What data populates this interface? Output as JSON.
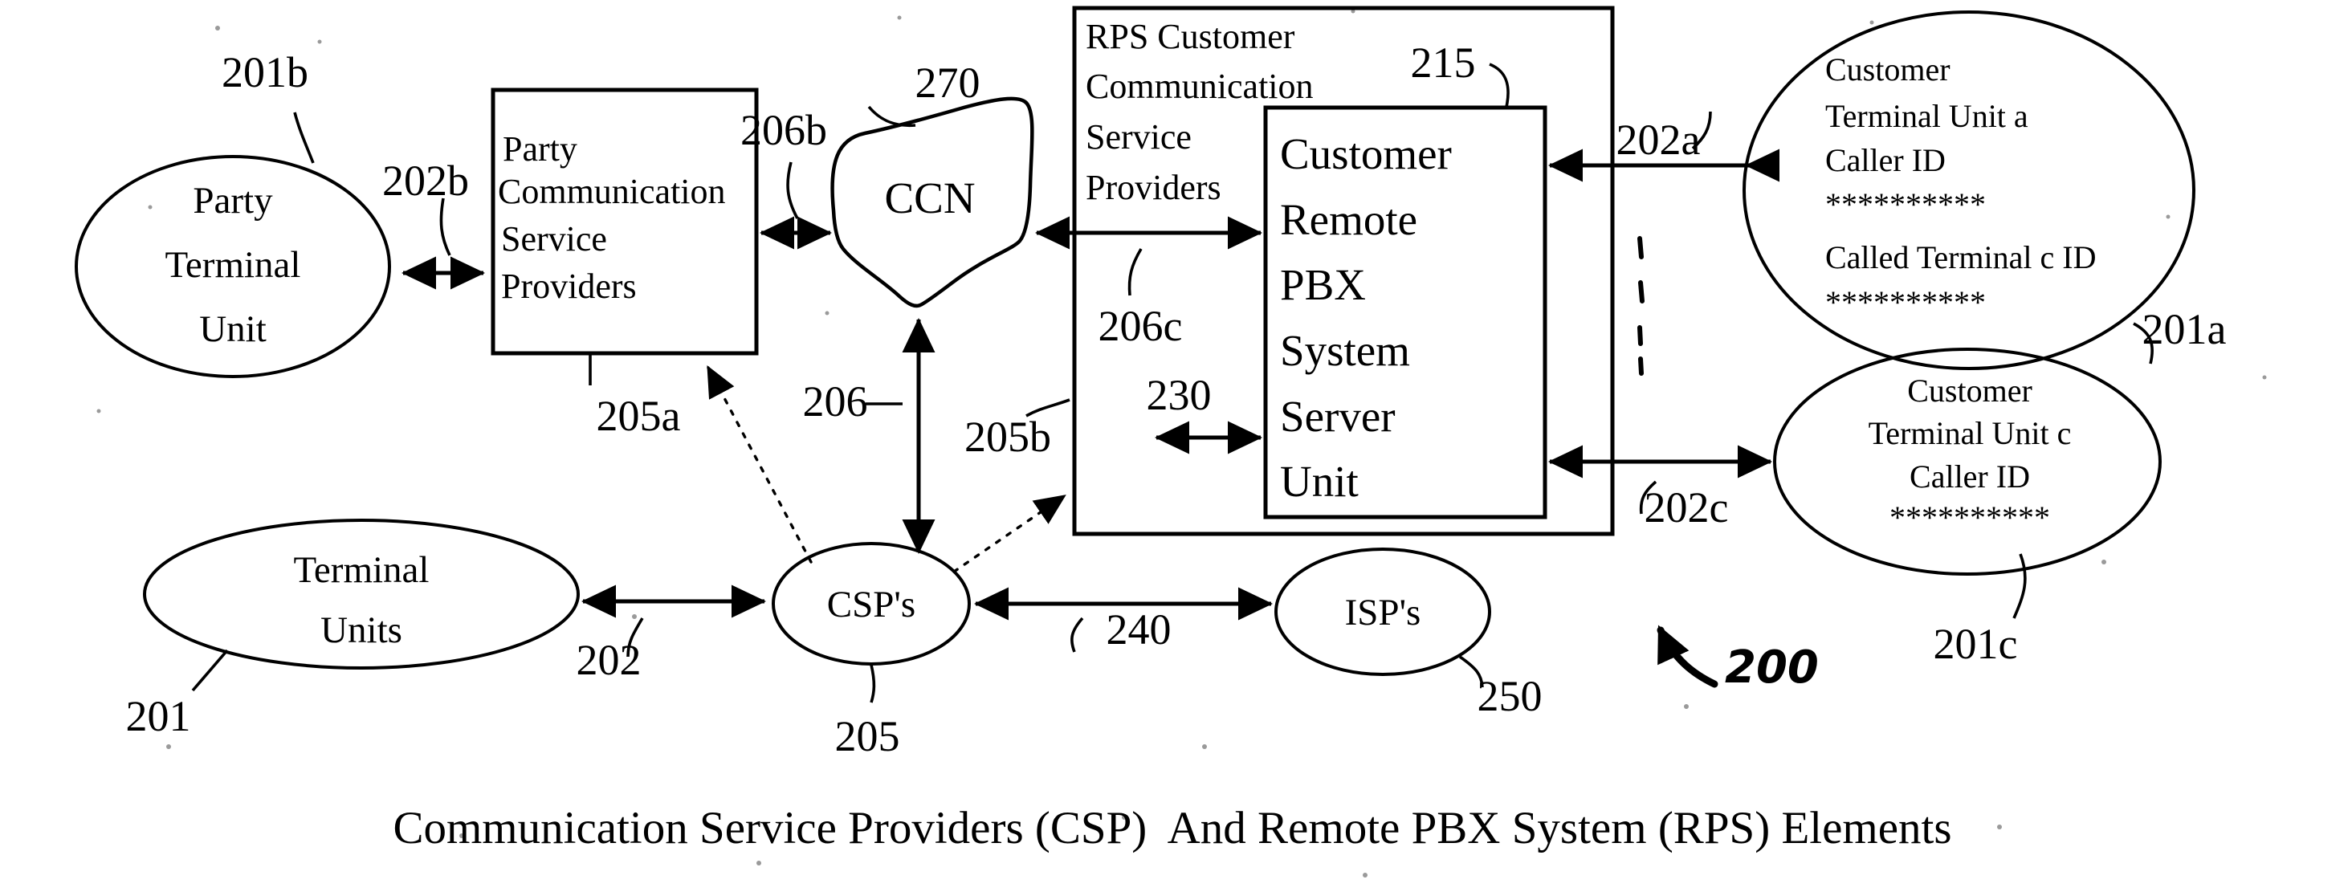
{
  "figure": {
    "caption": "Communication Service Providers (CSP)  And Remote PBX System (RPS) Elements",
    "handwritten_ref": "200"
  },
  "nodes": {
    "party_terminal_unit": {
      "lines": [
        "Party",
        "Terminal",
        "Unit"
      ],
      "ref": "201b",
      "shape": "ellipse"
    },
    "party_csp_box": {
      "lines": [
        "Party",
        "Communication",
        "Service",
        "Providers"
      ],
      "ref": "205a",
      "shape": "rectangle"
    },
    "ccn": {
      "label": "CCN",
      "ref": "270",
      "shape": "cloud"
    },
    "rps_outer_box": {
      "lines": [
        "RPS Customer",
        "Communication",
        "Service",
        "Providers"
      ],
      "ref": "215",
      "shape": "rectangle"
    },
    "customer_remote_pbx": {
      "lines": [
        "Customer",
        "Remote",
        "PBX",
        "System",
        "Server",
        "Unit"
      ],
      "shape": "rectangle"
    },
    "customer_terminal_unit_a": {
      "lines": [
        "Customer",
        "Terminal Unit a",
        "Caller ID",
        "**********",
        "Called Terminal c ID",
        "**********"
      ],
      "ref": "201a",
      "shape": "ellipse"
    },
    "customer_terminal_unit_c": {
      "lines": [
        "Customer",
        "Terminal Unit c",
        "Caller ID",
        "**********"
      ],
      "ref": "201c",
      "shape": "ellipse"
    },
    "terminal_units": {
      "lines": [
        "Terminal",
        "Units"
      ],
      "ref": "201",
      "shape": "ellipse"
    },
    "csps": {
      "label": "CSP's",
      "ref": "205",
      "shape": "ellipse"
    },
    "isps": {
      "label": "ISP's",
      "ref": "250",
      "shape": "ellipse"
    }
  },
  "connector_refs": {
    "party_terminal_to_box": "202b",
    "box_to_ccn": "206b",
    "ccn_to_csps": "206",
    "rps_to_ccn": "206c",
    "csps_to_rps": "205b",
    "server_left": "230",
    "rps_to_unit_a": "202a",
    "rps_to_unit_c": "202c",
    "terminal_to_csps": "202",
    "csps_to_isps": "240"
  },
  "colors": {
    "ink": "#000000",
    "paper": "#ffffff"
  }
}
